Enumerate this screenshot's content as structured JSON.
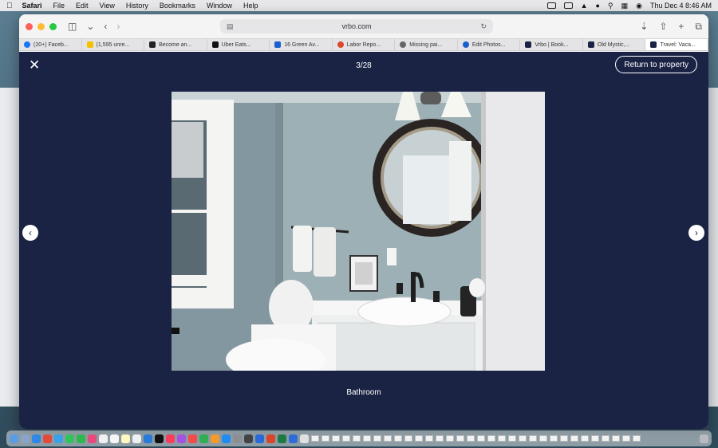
{
  "menubar": {
    "app_name": "Safari",
    "items": [
      "File",
      "Edit",
      "View",
      "History",
      "Bookmarks",
      "Window",
      "Help"
    ],
    "clock": "Thu Dec 4  8:46 AM"
  },
  "browser": {
    "url": "vrbo.com",
    "tabs": [
      {
        "label": "(20+) Faceb...",
        "color": "#1877f2"
      },
      {
        "label": "(1,595 unre...",
        "color": "#f2c200"
      },
      {
        "label": "Become an...",
        "color": "#222222"
      },
      {
        "label": "Uber Eats...",
        "color": "#111111"
      },
      {
        "label": "16 Green Av...",
        "color": "#1a5fd0"
      },
      {
        "label": "Labor Repo...",
        "color": "#d94a2b"
      },
      {
        "label": "Missing pai...",
        "color": "#666666"
      },
      {
        "label": "Edit Photos...",
        "color": "#1a5fd0"
      },
      {
        "label": "Vrbo | Book...",
        "color": "#1a2344"
      },
      {
        "label": "Old Mystic,...",
        "color": "#1a2344"
      },
      {
        "label": "Travel: Vaca...",
        "color": "#1a2344"
      }
    ]
  },
  "gallery": {
    "counter": "3/28",
    "return_label": "Return to property",
    "caption": "Bathroom"
  }
}
